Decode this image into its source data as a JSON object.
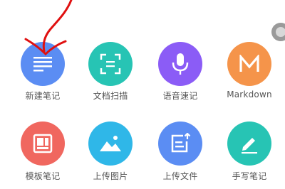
{
  "colors": {
    "blue": "#5b8df3",
    "teal": "#27c4b4",
    "purple": "#8b5cf6",
    "orange": "#f5944a",
    "red": "#f0675f",
    "sky": "#2fb7e8",
    "annotation": "#e01010"
  },
  "tiles": [
    {
      "label": "新建笔记",
      "icon": "lines-icon",
      "color": "#5b8df3"
    },
    {
      "label": "文档扫描",
      "icon": "scan-icon",
      "color": "#27c4b4"
    },
    {
      "label": "语音速记",
      "icon": "microphone-icon",
      "color": "#8b5cf6"
    },
    {
      "label": "Markdown",
      "icon": "markdown-m-icon",
      "color": "#f5944a"
    },
    {
      "label": "模板笔记",
      "icon": "template-icon",
      "color": "#f0675f"
    },
    {
      "label": "上传图片",
      "icon": "image-icon",
      "color": "#2fb7e8"
    },
    {
      "label": "上传文件",
      "icon": "file-upload-icon",
      "color": "#5b8df3"
    },
    {
      "label": "手写笔记",
      "icon": "pen-icon",
      "color": "#27c4b4"
    }
  ]
}
